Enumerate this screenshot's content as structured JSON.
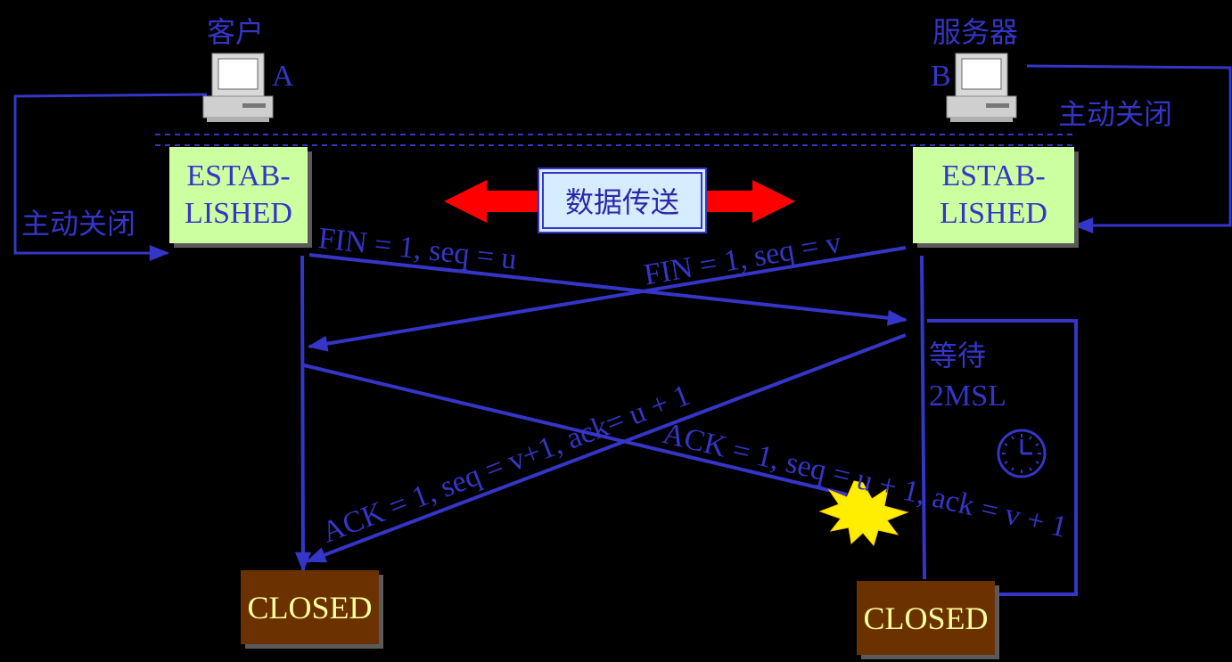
{
  "client": {
    "title": "客户",
    "letter": "A",
    "active_close": "主动关闭",
    "state": [
      "ESTAB-",
      "LISHED"
    ],
    "closed": "CLOSED"
  },
  "server": {
    "title": "服务器",
    "letter": "B",
    "active_close": "主动关闭",
    "state": [
      "ESTAB-",
      "LISHED"
    ],
    "closed": "CLOSED",
    "wait": [
      "等待",
      "2MSL"
    ]
  },
  "data_transfer": "数据传送",
  "messages": {
    "fin_client": "FIN = 1, seq = u",
    "fin_server": "FIN = 1, seq = v",
    "ack_to_client": "ACK = 1, seq = v+1, ack= u + 1",
    "ack_to_server": "ACK = 1, seq = u + 1, ack = v + 1"
  },
  "icons": [
    "computer-icon",
    "clock-icon",
    "explosion-icon"
  ],
  "colors": {
    "line": "#3535c8",
    "state_box": "#ccffa0",
    "closed_box": "#6b3200",
    "closed_text": "#ffffa0",
    "arrow": "#ff0000",
    "transfer_box": "#d6ecff",
    "burst": "#ffee00"
  }
}
